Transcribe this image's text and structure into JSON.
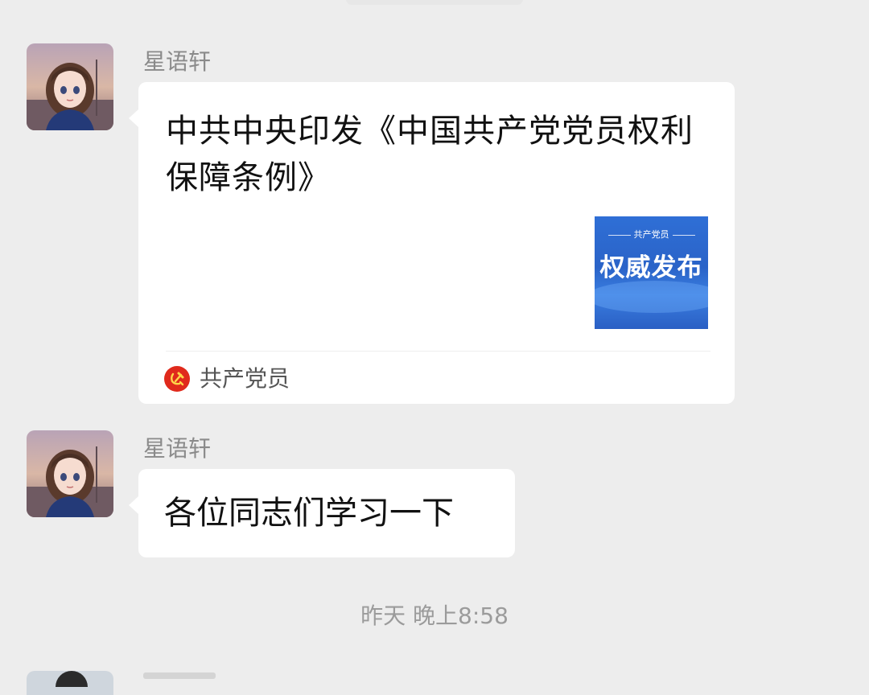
{
  "messages": [
    {
      "sender": "星语轩",
      "type": "article-card",
      "title": "中共中央印发《中国共产党党员权利保障条例》",
      "thumbnail": {
        "header": "共产党员",
        "title": "权威发布",
        "color": "#2f6fd6"
      },
      "source": "共产党员",
      "source_icon": "party-emblem-icon",
      "source_icon_color": "#e02a1c"
    },
    {
      "sender": "星语轩",
      "type": "text",
      "text": "各位同志们学习一下"
    }
  ],
  "timestamp": "昨天 晚上8:58",
  "colors": {
    "background": "#ededed",
    "bubble": "#ffffff",
    "sender_name": "#8a8a8a"
  }
}
